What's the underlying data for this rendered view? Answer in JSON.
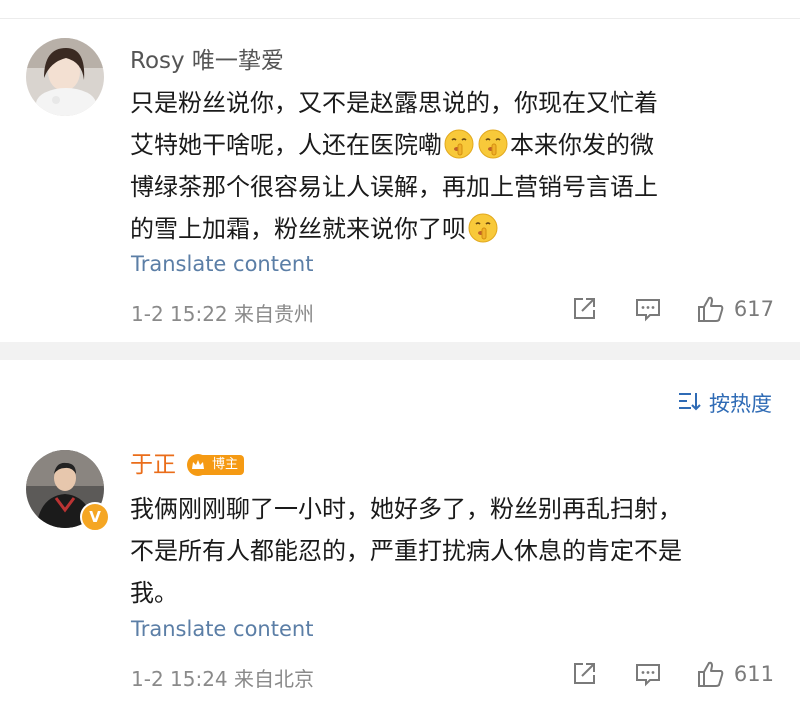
{
  "comments": [
    {
      "username": "Rosy 唯一挚爱",
      "lines": [
        "只是粉丝说你，又不是赵露思说的，你现在又忙着",
        "艾特她干啥呢，人还在医院嘞",
        "本来你发的微",
        "博绿茶那个很容易让人误解，再加上营销号言语上",
        "的雪上加霜，粉丝就来说你了呗"
      ],
      "translate_label": "Translate content",
      "timestamp": "1-2 15:22",
      "location": "来自贵州",
      "likes": "617"
    },
    {
      "username": "于正",
      "badge": "博主",
      "lines": [
        "我俩刚刚聊了一小时，她好多了，粉丝别再乱扫射，",
        "不是所有人都能忍的，严重打扰病人休息的肯定不是",
        "我。"
      ],
      "translate_label": "Translate content",
      "timestamp": "1-2 15:24",
      "location": "来自北京",
      "likes": "611"
    }
  ],
  "sort": {
    "label": "按热度"
  },
  "icons": {
    "share": "share-icon",
    "comment": "comment-icon",
    "like": "thumbs-up-icon",
    "emoji": "shushing-face-emoji",
    "verified": "verified-v-badge"
  },
  "colors": {
    "link": "#5b7ea6",
    "username_vip": "#ea6d1a",
    "sort": "#2f6bb5",
    "badge": "#f59a13"
  }
}
